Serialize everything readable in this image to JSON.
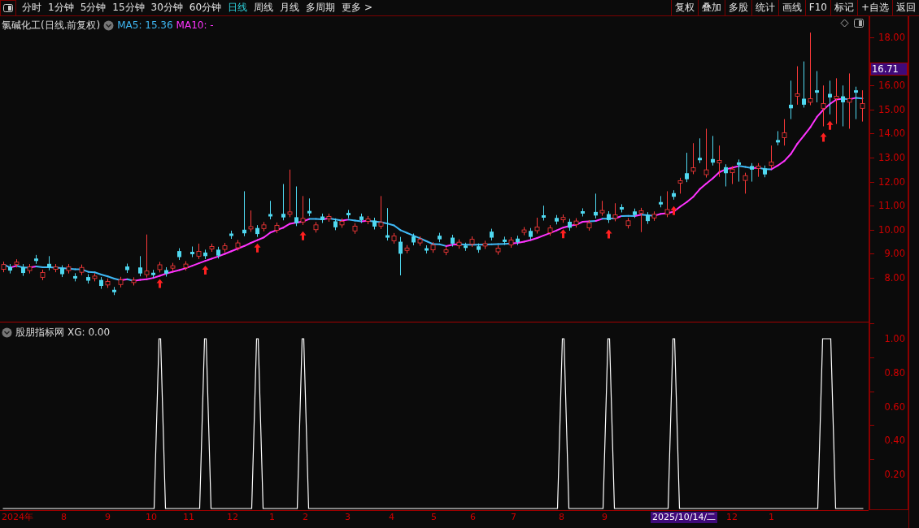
{
  "toolbar": {
    "periods": [
      {
        "label": "分时",
        "selected": false
      },
      {
        "label": "1分钟",
        "selected": false
      },
      {
        "label": "5分钟",
        "selected": false
      },
      {
        "label": "15分钟",
        "selected": false
      },
      {
        "label": "30分钟",
        "selected": false
      },
      {
        "label": "60分钟",
        "selected": false
      },
      {
        "label": "日线",
        "selected": true
      },
      {
        "label": "周线",
        "selected": false
      },
      {
        "label": "月线",
        "selected": false
      },
      {
        "label": "多周期",
        "selected": false
      },
      {
        "label": "更多 >",
        "selected": false
      }
    ],
    "actions": [
      "复权",
      "叠加",
      "多股",
      "统计",
      "画线",
      "F10",
      "标记",
      "+自选",
      "返回"
    ]
  },
  "main_chart": {
    "title": "氯碱化工(日线.前复权)",
    "ma5": "MA5: 15.36",
    "ma10": "MA10: -",
    "current_price": "16.71",
    "chart_data": {
      "type": "candlestick",
      "ylim": [
        6.14,
        18.88
      ],
      "yticks": [
        {
          "value": 18,
          "label": "18.00"
        },
        {
          "value": 16,
          "label": "16.00"
        },
        {
          "value": 15,
          "label": "15.00"
        },
        {
          "value": 14,
          "label": "14.00"
        },
        {
          "value": 13,
          "label": "13.00"
        },
        {
          "value": 12,
          "label": "12.00"
        },
        {
          "value": 11,
          "label": "11.00"
        },
        {
          "value": 10,
          "label": "10.00"
        },
        {
          "value": 9,
          "label": "9.00"
        },
        {
          "value": 8,
          "label": "8.00"
        }
      ],
      "ohlc": [
        [
          8.35,
          8.67,
          8.23,
          8.55
        ],
        [
          8.45,
          8.57,
          8.18,
          8.3
        ],
        [
          8.55,
          8.77,
          8.43,
          8.65
        ],
        [
          8.45,
          8.57,
          8.08,
          8.2
        ],
        [
          8.3,
          8.57,
          8.18,
          8.45
        ],
        [
          8.8,
          8.95,
          8.58,
          8.7
        ],
        [
          8.02,
          8.34,
          7.9,
          8.22
        ],
        [
          8.58,
          8.9,
          8.31,
          8.43
        ],
        [
          8.35,
          8.57,
          8.23,
          8.45
        ],
        [
          8.4,
          8.52,
          8.03,
          8.15
        ],
        [
          8.3,
          8.57,
          8.18,
          8.45
        ],
        [
          8.07,
          8.19,
          7.85,
          7.97
        ],
        [
          8.23,
          8.55,
          8.11,
          8.43
        ],
        [
          8.03,
          8.15,
          7.76,
          7.88
        ],
        [
          7.97,
          8.19,
          7.85,
          8.07
        ],
        [
          7.91,
          8.03,
          7.54,
          7.66
        ],
        [
          7.7,
          7.97,
          7.58,
          7.85
        ],
        [
          7.5,
          7.62,
          7.28,
          7.4
        ],
        [
          7.72,
          8.04,
          7.6,
          7.92
        ],
        [
          8.47,
          8.59,
          8.2,
          8.32
        ],
        [
          7.8,
          8.02,
          7.68,
          7.9
        ],
        [
          8.43,
          8.9,
          8.06,
          8.18
        ],
        [
          8.13,
          9.8,
          8.01,
          8.28
        ],
        [
          8.21,
          8.33,
          7.99,
          8.11
        ],
        [
          8.34,
          8.66,
          8.22,
          8.54
        ],
        [
          8.32,
          8.44,
          8.05,
          8.17
        ],
        [
          8.4,
          8.62,
          8.28,
          8.5
        ],
        [
          9.11,
          9.23,
          8.74,
          8.86
        ],
        [
          8.42,
          8.69,
          8.3,
          8.57
        ],
        [
          9.08,
          9.3,
          8.86,
          8.98
        ],
        [
          8.9,
          9.42,
          8.78,
          9.1
        ],
        [
          9.05,
          9.17,
          8.78,
          8.9
        ],
        [
          9.2,
          9.42,
          9.08,
          9.3
        ],
        [
          9.17,
          9.29,
          8.8,
          8.92
        ],
        [
          9.18,
          9.45,
          9.06,
          9.33
        ],
        [
          9.84,
          9.96,
          9.62,
          9.74
        ],
        [
          9.25,
          9.57,
          9.13,
          9.45
        ],
        [
          10.0,
          11.6,
          9.73,
          9.85
        ],
        [
          10.03,
          10.8,
          9.91,
          10.13
        ],
        [
          10.07,
          10.19,
          9.7,
          9.82
        ],
        [
          10.05,
          10.32,
          9.93,
          10.2
        ],
        [
          10.65,
          11.2,
          10.43,
          10.55
        ],
        [
          9.98,
          10.3,
          9.86,
          10.18
        ],
        [
          10.66,
          11.9,
          10.39,
          10.51
        ],
        [
          10.64,
          12.5,
          10.52,
          10.74
        ],
        [
          10.52,
          11.8,
          10.15,
          10.27
        ],
        [
          10.32,
          11.4,
          10.2,
          10.47
        ],
        [
          10.78,
          11.3,
          10.56,
          10.68
        ],
        [
          10.0,
          10.32,
          9.88,
          10.2
        ],
        [
          10.55,
          10.67,
          10.28,
          10.4
        ],
        [
          10.45,
          10.67,
          10.33,
          10.55
        ],
        [
          10.35,
          10.47,
          9.98,
          10.1
        ],
        [
          10.2,
          10.47,
          10.08,
          10.35
        ],
        [
          10.7,
          10.82,
          10.48,
          10.6
        ],
        [
          9.95,
          10.27,
          9.83,
          10.15
        ],
        [
          10.55,
          10.67,
          10.28,
          10.4
        ],
        [
          10.35,
          10.57,
          10.23,
          10.45
        ],
        [
          10.38,
          10.5,
          10.01,
          10.13
        ],
        [
          10.15,
          11.4,
          10.03,
          10.3
        ],
        [
          9.77,
          10.9,
          9.55,
          9.67
        ],
        [
          9.54,
          9.86,
          9.42,
          9.74
        ],
        [
          9.5,
          9.7,
          8.1,
          9.0
        ],
        [
          9.14,
          9.36,
          9.02,
          9.24
        ],
        [
          9.72,
          9.84,
          9.35,
          9.47
        ],
        [
          9.45,
          9.72,
          9.33,
          9.6
        ],
        [
          9.23,
          9.35,
          9.01,
          9.13
        ],
        [
          9.16,
          9.48,
          9.04,
          9.36
        ],
        [
          9.75,
          9.87,
          9.48,
          9.6
        ],
        [
          9.06,
          9.28,
          8.94,
          9.16
        ],
        [
          9.67,
          9.79,
          9.3,
          9.42
        ],
        [
          9.33,
          9.6,
          9.21,
          9.48
        ],
        [
          9.34,
          9.46,
          9.12,
          9.24
        ],
        [
          9.4,
          9.72,
          9.28,
          9.6
        ],
        [
          9.31,
          9.43,
          9.04,
          9.16
        ],
        [
          9.32,
          9.54,
          9.2,
          9.42
        ],
        [
          9.92,
          10.04,
          9.55,
          9.67
        ],
        [
          9.08,
          9.35,
          8.96,
          9.23
        ],
        [
          9.59,
          9.71,
          9.37,
          9.49
        ],
        [
          9.37,
          9.69,
          9.25,
          9.57
        ],
        [
          9.63,
          9.75,
          9.36,
          9.48
        ],
        [
          9.89,
          10.11,
          9.77,
          9.99
        ],
        [
          9.95,
          10.07,
          9.58,
          9.7
        ],
        [
          9.96,
          10.5,
          9.84,
          10.11
        ],
        [
          10.6,
          11.0,
          10.38,
          10.5
        ],
        [
          9.87,
          10.19,
          9.75,
          10.07
        ],
        [
          10.49,
          10.61,
          10.22,
          10.34
        ],
        [
          10.41,
          10.63,
          10.29,
          10.51
        ],
        [
          10.33,
          10.45,
          9.96,
          10.08
        ],
        [
          10.21,
          10.48,
          10.09,
          10.36
        ],
        [
          10.77,
          10.89,
          10.55,
          10.67
        ],
        [
          10.08,
          10.4,
          9.96,
          10.28
        ],
        [
          10.74,
          11.5,
          10.47,
          10.59
        ],
        [
          10.7,
          11.2,
          10.58,
          10.8
        ],
        [
          10.65,
          10.77,
          10.28,
          10.4
        ],
        [
          10.47,
          11.1,
          10.35,
          10.62
        ],
        [
          10.94,
          11.06,
          10.72,
          10.84
        ],
        [
          10.17,
          10.49,
          10.05,
          10.37
        ],
        [
          10.76,
          10.88,
          10.49,
          10.61
        ],
        [
          10.69,
          10.91,
          9.9,
          10.79
        ],
        [
          10.61,
          10.73,
          10.24,
          10.36
        ],
        [
          10.49,
          10.76,
          10.37,
          10.64
        ],
        [
          11.15,
          11.4,
          10.93,
          11.05
        ],
        [
          10.64,
          11.6,
          10.52,
          10.84
        ],
        [
          11.52,
          11.64,
          11.25,
          11.37
        ],
        [
          11.94,
          12.16,
          11.5,
          12.04
        ],
        [
          12.35,
          13.2,
          11.98,
          12.1
        ],
        [
          12.43,
          13.6,
          12.31,
          12.58
        ],
        [
          12.99,
          13.8,
          12.77,
          12.89
        ],
        [
          12.29,
          14.2,
          12.17,
          12.49
        ],
        [
          12.94,
          13.9,
          12.67,
          12.79
        ],
        [
          12.78,
          13.5,
          12.2,
          12.88
        ],
        [
          12.6,
          12.72,
          11.8,
          12.35
        ],
        [
          12.37,
          12.64,
          11.9,
          12.52
        ],
        [
          12.8,
          12.92,
          12.0,
          12.7
        ],
        [
          12.05,
          12.37,
          11.5,
          12.25
        ],
        [
          12.65,
          12.77,
          12.0,
          12.5
        ],
        [
          12.55,
          12.77,
          12.2,
          12.65
        ],
        [
          12.55,
          12.67,
          12.18,
          12.3
        ],
        [
          12.67,
          13.5,
          12.55,
          12.82
        ],
        [
          13.73,
          14.1,
          13.51,
          13.63
        ],
        [
          13.83,
          14.6,
          13.5,
          14.03
        ],
        [
          15.2,
          16.2,
          14.6,
          15.05
        ],
        [
          15.55,
          16.8,
          15.2,
          15.65
        ],
        [
          15.45,
          17.0,
          15.08,
          15.2
        ],
        [
          15.3,
          18.2,
          15.18,
          15.45
        ],
        [
          15.8,
          16.6,
          15.3,
          15.7
        ],
        [
          15.05,
          16.0,
          14.3,
          15.25
        ],
        [
          15.65,
          16.2,
          14.8,
          15.5
        ],
        [
          15.45,
          16.3,
          14.4,
          15.55
        ],
        [
          15.55,
          16.0,
          14.3,
          15.3
        ],
        [
          15.3,
          16.5,
          14.2,
          15.45
        ],
        [
          15.8,
          15.95,
          14.6,
          15.7
        ],
        [
          15.05,
          15.8,
          14.5,
          15.25
        ]
      ]
    }
  },
  "indicator": {
    "title": "股朋指标网",
    "value": "XG: 0.00",
    "chart_data": {
      "type": "line",
      "ylim": [
        0,
        1
      ],
      "yticks": [
        {
          "value": 1,
          "label": "1.00"
        },
        {
          "value": 0.8,
          "label": "0.80"
        },
        {
          "value": 0.6,
          "label": "0.60"
        },
        {
          "value": 0.4,
          "label": "0.40"
        },
        {
          "value": 0.2,
          "label": "0.20"
        }
      ],
      "series": [
        {
          "color": "#ffffff",
          "values": [
            0,
            0,
            0,
            0,
            0,
            0,
            0,
            0,
            0,
            0,
            0,
            0,
            0,
            0,
            0,
            0,
            0,
            0,
            0,
            0,
            0,
            0,
            0,
            0,
            1,
            0,
            0,
            0,
            0,
            0,
            0,
            1,
            0,
            0,
            0,
            0,
            0,
            0,
            0,
            1,
            0,
            0,
            0,
            0,
            0,
            0,
            1,
            0,
            0,
            0,
            0,
            0,
            0,
            0,
            0,
            0,
            0,
            0,
            0,
            0,
            0,
            0,
            0,
            0,
            0,
            0,
            0,
            0,
            0,
            0,
            0,
            0,
            0,
            0,
            0,
            0,
            0,
            0,
            0,
            0,
            0,
            0,
            0,
            0,
            0,
            0,
            1,
            0,
            0,
            0,
            0,
            0,
            0,
            1,
            0,
            0,
            0,
            0,
            0,
            0,
            0,
            0,
            0,
            1,
            0,
            0,
            0,
            0,
            0,
            0,
            0,
            0,
            0,
            0,
            0,
            0,
            0,
            0,
            0,
            0,
            0,
            0,
            0,
            0,
            0,
            0,
            1,
            1,
            0,
            0,
            0,
            0,
            0
          ]
        }
      ]
    }
  },
  "date_axis": [
    {
      "label": "2024年",
      "selected": false
    },
    {
      "label": "8",
      "selected": false
    },
    {
      "label": "9",
      "selected": false
    },
    {
      "label": "10",
      "selected": false
    },
    {
      "label": "11",
      "selected": false
    },
    {
      "label": "12",
      "selected": false
    },
    {
      "label": "1",
      "selected": false
    },
    {
      "label": "2",
      "selected": false
    },
    {
      "label": "3",
      "selected": false
    },
    {
      "label": "4",
      "selected": false
    },
    {
      "label": "5",
      "selected": false
    },
    {
      "label": "6",
      "selected": false
    },
    {
      "label": "7",
      "selected": false
    },
    {
      "label": "8",
      "selected": false
    },
    {
      "label": "9",
      "selected": false
    },
    {
      "label": "2025/10/14/二",
      "selected": true
    },
    {
      "label": "12",
      "selected": false
    },
    {
      "label": "1",
      "selected": false
    }
  ]
}
